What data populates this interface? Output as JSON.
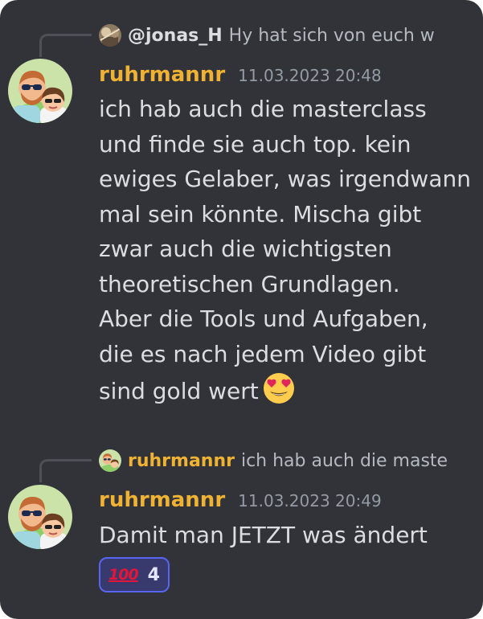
{
  "messages": [
    {
      "reply": {
        "author": "@jonas_H",
        "author_color": "#dbdee1",
        "preview": "Hy hat sich von euch w"
      },
      "username": "ruhrmannr",
      "username_color": "#f0b232",
      "timestamp": "11.03.2023 20:48",
      "lines": [
        "ich hab auch die masterclass",
        "und finde sie auch top. kein",
        "ewiges Gelaber, was irgendwann",
        "mal sein könnte. Mischa gibt",
        "zwar auch die wichtigsten",
        "theoretischen Grundlagen.",
        "Aber die Tools und Aufgaben,",
        "die es nach jedem Video gibt",
        "sind gold wert"
      ],
      "trailing_emoji": "heart-eyes-emoji"
    },
    {
      "reply": {
        "author": "ruhrmannr",
        "author_color": "#f0b232",
        "preview": "ich hab auch die maste"
      },
      "username": "ruhrmannr",
      "username_color": "#f0b232",
      "timestamp": "11.03.2023 20:49",
      "text": "Damit man JETZT was ändert",
      "reaction": {
        "emoji": "100",
        "emoji_name": "hundred-points-emoji",
        "count": "4"
      }
    }
  ],
  "colors": {
    "background": "#313338",
    "text": "#dbdee1",
    "muted": "#949ba4",
    "reaction_bg": "#383a6d",
    "reaction_border": "#5865f2"
  }
}
